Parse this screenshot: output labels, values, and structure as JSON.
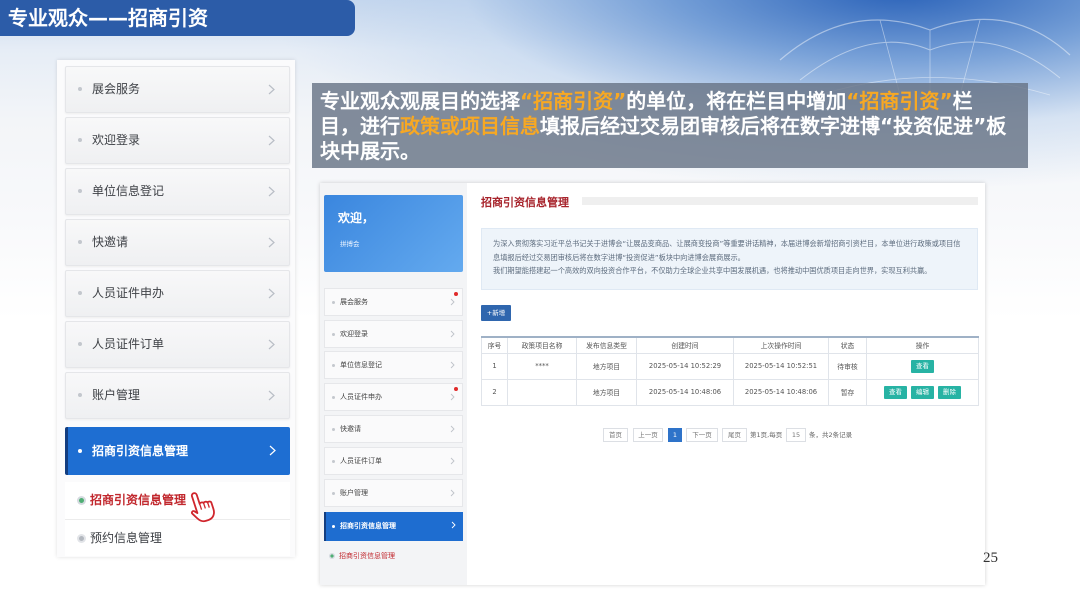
{
  "slide": {
    "title": "专业观众——招商引资",
    "page_number": "25",
    "callout": {
      "segments": [
        {
          "text": "专业观众观展目的选择",
          "highlight": false
        },
        {
          "text": "“招商引资”",
          "highlight": true
        },
        {
          "text": "的单位，将在栏目中增加",
          "highlight": false
        },
        {
          "text": "“招商引资”",
          "highlight": true
        },
        {
          "text": "栏目，进行",
          "highlight": false
        },
        {
          "text": "政策或项目信息",
          "highlight": true
        },
        {
          "text": "填报后经过交易团审核后将在数字进博“投资促进”板块中展示。",
          "highlight": false
        }
      ]
    }
  },
  "big_menu": {
    "items": [
      {
        "label": "展会服务"
      },
      {
        "label": "欢迎登录"
      },
      {
        "label": "单位信息登记"
      },
      {
        "label": "快邀请"
      },
      {
        "label": "人员证件申办"
      },
      {
        "label": "人员证件订单"
      },
      {
        "label": "账户管理"
      }
    ],
    "active": {
      "label": "招商引资信息管理"
    },
    "sub_items": [
      {
        "label": "招商引资信息管理",
        "active": true
      },
      {
        "label": "预约信息管理",
        "active": false
      }
    ]
  },
  "app": {
    "welcome": {
      "title": "欢迎，",
      "user": "拼搏会"
    },
    "menu": [
      {
        "label": "展会服务",
        "badge": true
      },
      {
        "label": "欢迎登录",
        "badge": false
      },
      {
        "label": "单位信息登记",
        "badge": false
      },
      {
        "label": "人员证件申办",
        "badge": true
      },
      {
        "label": "快邀请",
        "badge": false
      },
      {
        "label": "人员证件订单",
        "badge": false
      },
      {
        "label": "账户管理",
        "badge": false
      }
    ],
    "menu_active": "招商引资信息管理",
    "menu_sub": "招商引资信息管理",
    "page_title": "招商引资信息管理",
    "notice": [
      "为深入贯彻落实习近平总书记关于进博会“让展品变商品、让展商变投商”等重要讲话精神，本届进博会新增招商引资栏目，本单位进行政策或项目信息填报后经过交易团审核后将在数字进博“投资促进”板块中向进博会展商展示。",
      "我们期望能搭建起一个高效的双向投资合作平台，不仅助力全球企业共享中国发展机遇，也将推动中国优质项目走向世界，实现互利共赢。"
    ],
    "add_button": "+新增",
    "table": {
      "headers": [
        "序号",
        "政策项目名称",
        "发布信息类型",
        "创建时间",
        "上次操作时间",
        "状态",
        "操作"
      ],
      "rows": [
        {
          "no": "1",
          "name": "****",
          "type": "地方项目",
          "created": "2025-05-14 10:52:29",
          "updated": "2025-05-14 10:52:51",
          "status": "待审核",
          "actions": [
            "查看"
          ]
        },
        {
          "no": "2",
          "name": "",
          "type": "地方项目",
          "created": "2025-05-14 10:48:06",
          "updated": "2025-05-14 10:48:06",
          "status": "暂存",
          "actions": [
            "查看",
            "编辑",
            "删除"
          ]
        }
      ]
    },
    "pagination": {
      "first": "首页",
      "prev": "上一页",
      "current": "1",
      "next": "下一页",
      "last": "尾页",
      "page_info": "第1页,每页",
      "page_size": "15",
      "total_info": "条，共2条记录"
    }
  },
  "colors": {
    "title_bar": "#2c5ca8",
    "menu_active": "#1e6ed2",
    "highlight_orange": "#f7a823",
    "accent_red": "#c1272d",
    "action_teal": "#27b3a4"
  },
  "icons": {
    "chevron": "chevron-right-icon",
    "pointer": "hand-pointer-icon",
    "badge": "red-dot-badge"
  }
}
